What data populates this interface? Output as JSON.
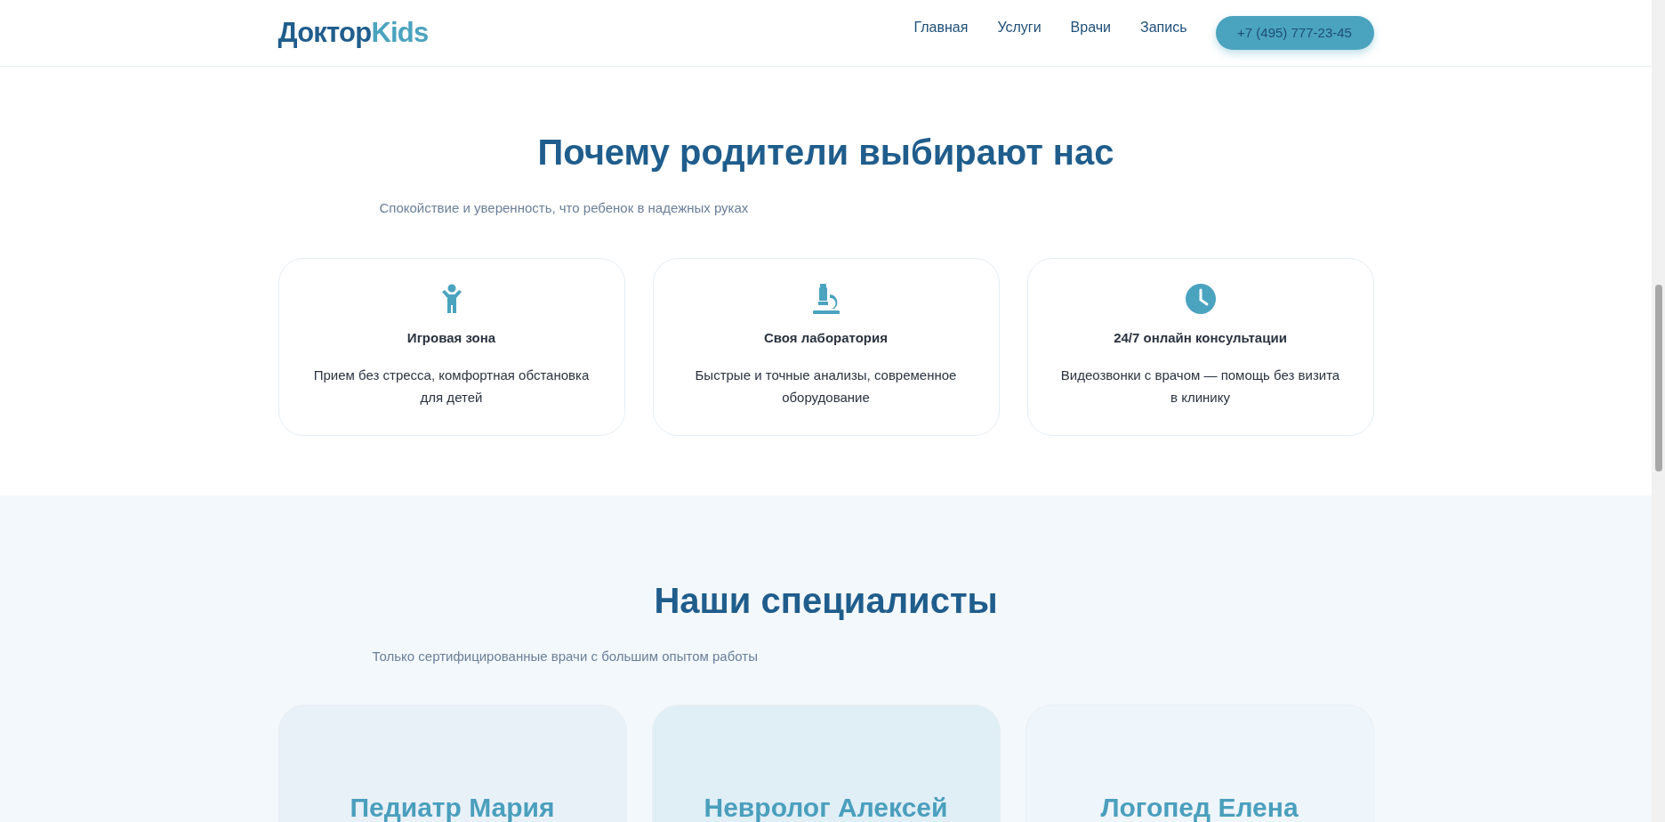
{
  "header": {
    "logo": {
      "part_1": "Доктор",
      "part_2": "Kids"
    },
    "nav": [
      {
        "label": "Главная"
      },
      {
        "label": "Услуги"
      },
      {
        "label": "Врачи"
      },
      {
        "label": "Запись"
      }
    ],
    "phone_button": "+7 (495) 777-23-45"
  },
  "features": {
    "title": "Почему родители выбирают нас",
    "subtitle": "Спокойствие и уверенность, что ребенок в надежных руках",
    "cards": [
      {
        "kind": "child",
        "title": "Игровая зона",
        "text": "Прием без стресса, комфортная обстановка для детей"
      },
      {
        "kind": "microscope",
        "title": "Своя лаборатория",
        "text": "Быстрые и точные анализы, современное оборудование"
      },
      {
        "kind": "clock",
        "title": "24/7 онлайн консультации",
        "text": "Видеозвонки с врачом — помощь без визита в клинику"
      }
    ]
  },
  "specialists": {
    "title": "Наши специалисты",
    "subtitle": "Только сертифицированные врачи с большим опытом работы",
    "cards": [
      {
        "name": "Педиатр Мария",
        "color": "#e9f1f8"
      },
      {
        "name": "Невролог Алексей",
        "color": "#e0eef6"
      },
      {
        "name": "Логопед Елена",
        "color": "#eef5fb"
      }
    ]
  }
}
